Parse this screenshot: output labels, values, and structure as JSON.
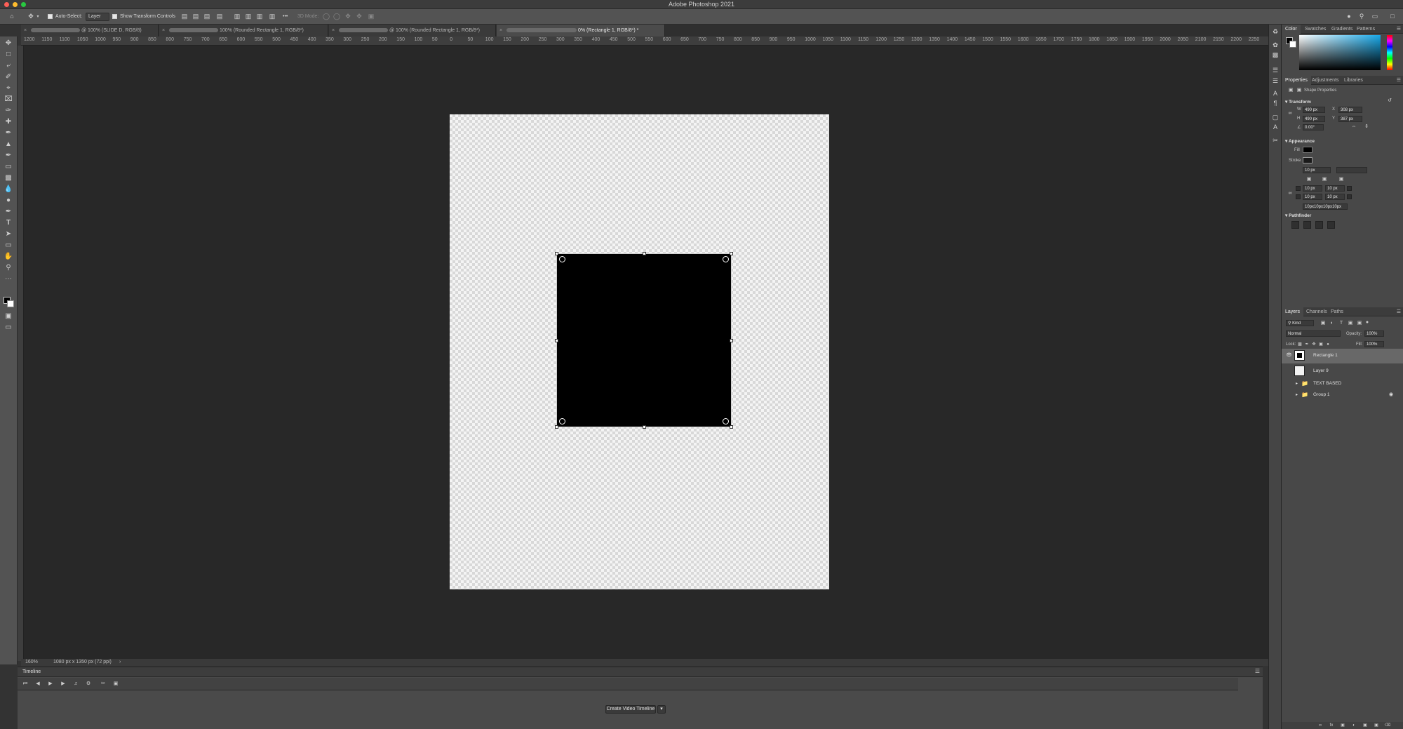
{
  "app": {
    "title": "Adobe Photoshop 2021"
  },
  "traffic_lights": {
    "close": "#fd5f57",
    "minimize": "#febc2e",
    "zoom": "#28c840"
  },
  "options_bar": {
    "home_icon": "home-icon",
    "move_tool_icon": "move-tool-icon",
    "auto_select_label": "Auto-Select:",
    "auto_select_value": "Layer",
    "show_transform_label": "Show Transform Controls",
    "mode_3d_label": "3D Mode:",
    "more_label": "•••"
  },
  "tabs": [
    {
      "label": "@ 100% (SLIDE D, RGB/8)",
      "active": false
    },
    {
      "label": "100% (Rounded Rectangle 1, RGB/8*)",
      "active": false
    },
    {
      "label": "@ 100% (Rounded Rectangle 1, RGB/8*)",
      "active": false
    },
    {
      "label": "0% (Rectangle 1, RGB/8*) *",
      "active": true
    }
  ],
  "ruler": {
    "h_ticks": [
      "1200",
      "1150",
      "1100",
      "1050",
      "1000",
      "950",
      "900",
      "850",
      "800",
      "750",
      "700",
      "650",
      "600",
      "550",
      "500",
      "450",
      "400",
      "350",
      "300",
      "250",
      "200",
      "150",
      "100",
      "50",
      "0",
      "50",
      "100",
      "150",
      "200",
      "250",
      "300",
      "350",
      "400",
      "450",
      "500",
      "550",
      "600",
      "650",
      "700",
      "750",
      "800",
      "850",
      "900",
      "950",
      "1000",
      "1050",
      "1100",
      "1150",
      "1200",
      "1250",
      "1300",
      "1350",
      "1400",
      "1450",
      "1500",
      "1550",
      "1600",
      "1650",
      "1700",
      "1750",
      "1800",
      "1850",
      "1900",
      "1950",
      "2000",
      "2050",
      "2100",
      "2150",
      "2200",
      "2250"
    ]
  },
  "status_bar": {
    "zoom": "160%",
    "doc_info": "1080 px x 1350 px (72 ppi)",
    "arrow": "›"
  },
  "timeline": {
    "title": "Timeline",
    "create_button": "Create Video Timeline"
  },
  "color_panel": {
    "tabs": [
      "Color",
      "Swatches",
      "Gradients",
      "Patterns"
    ],
    "active": "Color",
    "hue_color": "#18a8e8",
    "foreground": "#000000",
    "background": "#ffffff"
  },
  "properties_panel": {
    "tabs": [
      "Properties",
      "Adjustments",
      "Libraries"
    ],
    "active": "Properties",
    "subtitle": "Shape Properties",
    "transform_title": "Transform",
    "w_label": "W",
    "w_value": "490 px",
    "h_label": "H",
    "h_value": "490 px",
    "x_label": "X",
    "x_value": "308 px",
    "y_label": "Y",
    "y_value": "387 px",
    "angle_value": "0.00°",
    "appearance_title": "Appearance",
    "fill_label": "Fill",
    "fill_color": "#000000",
    "stroke_label": "Stroke",
    "stroke_width": "10 px",
    "radius_tl": "10 px",
    "radius_tr": "10 px",
    "radius_bl": "10 px",
    "radius_br": "10 px",
    "radius_summary": "10px10px10px10px",
    "pathfinder_title": "Pathfinder"
  },
  "layers_panel": {
    "tabs": [
      "Layers",
      "Channels",
      "Paths"
    ],
    "active": "Layers",
    "filter_label": "Kind",
    "blend_mode": "Normal",
    "opacity_label": "Opacity:",
    "opacity_value": "100%",
    "lock_label": "Lock:",
    "fill_label": "Fill:",
    "fill_value": "100%",
    "layers": [
      {
        "name": "Rectangle 1",
        "selected": true,
        "visible": true,
        "type": "shape"
      },
      {
        "name": "Layer 9",
        "selected": false,
        "visible": false,
        "type": "pixel"
      },
      {
        "name": "TEXT BASED",
        "selected": false,
        "visible": false,
        "type": "group"
      },
      {
        "name": "Group 1",
        "selected": false,
        "visible": false,
        "type": "group",
        "locked": true
      }
    ]
  }
}
